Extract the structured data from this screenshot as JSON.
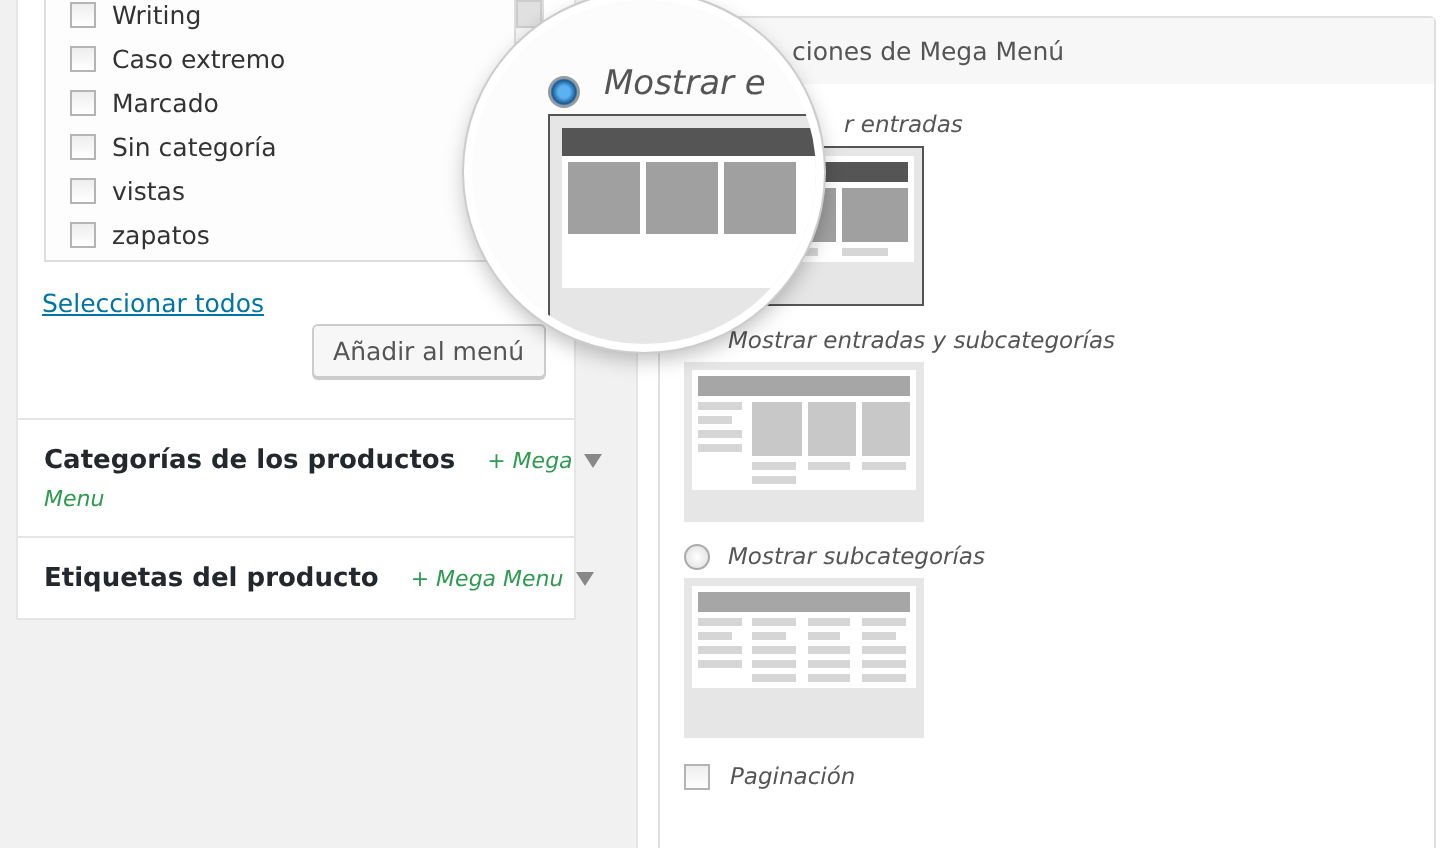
{
  "categories": {
    "items": [
      {
        "label": "Writing",
        "checked": false
      },
      {
        "label": "Caso extremo",
        "checked": false
      },
      {
        "label": "Marcado",
        "checked": false
      },
      {
        "label": "Sin categoría",
        "checked": false
      },
      {
        "label": "vistas",
        "checked": false
      },
      {
        "label": "zapatos",
        "checked": false
      }
    ],
    "select_all": "Seleccionar todos",
    "add_button": "Añadir al menú"
  },
  "sections": [
    {
      "title": "Categorías de los productos",
      "badge_first": "+ Mega",
      "badge_rest": "Menu"
    },
    {
      "title": "Etiquetas del producto",
      "badge_first": "+ Mega Menu"
    }
  ],
  "mega_menu": {
    "heading": "ciones de Mega Menú",
    "options": [
      {
        "label": "r entradas",
        "selected": true,
        "kind": "posts"
      },
      {
        "label": "Mostrar entradas y subcategorías",
        "selected": false,
        "kind": "mixed"
      },
      {
        "label": "Mostrar subcategorías",
        "selected": false,
        "kind": "subcats"
      }
    ],
    "pagination": {
      "label": "Paginación",
      "checked": false
    }
  },
  "magnifier": {
    "label": "Mostrar e",
    "selected": true
  }
}
